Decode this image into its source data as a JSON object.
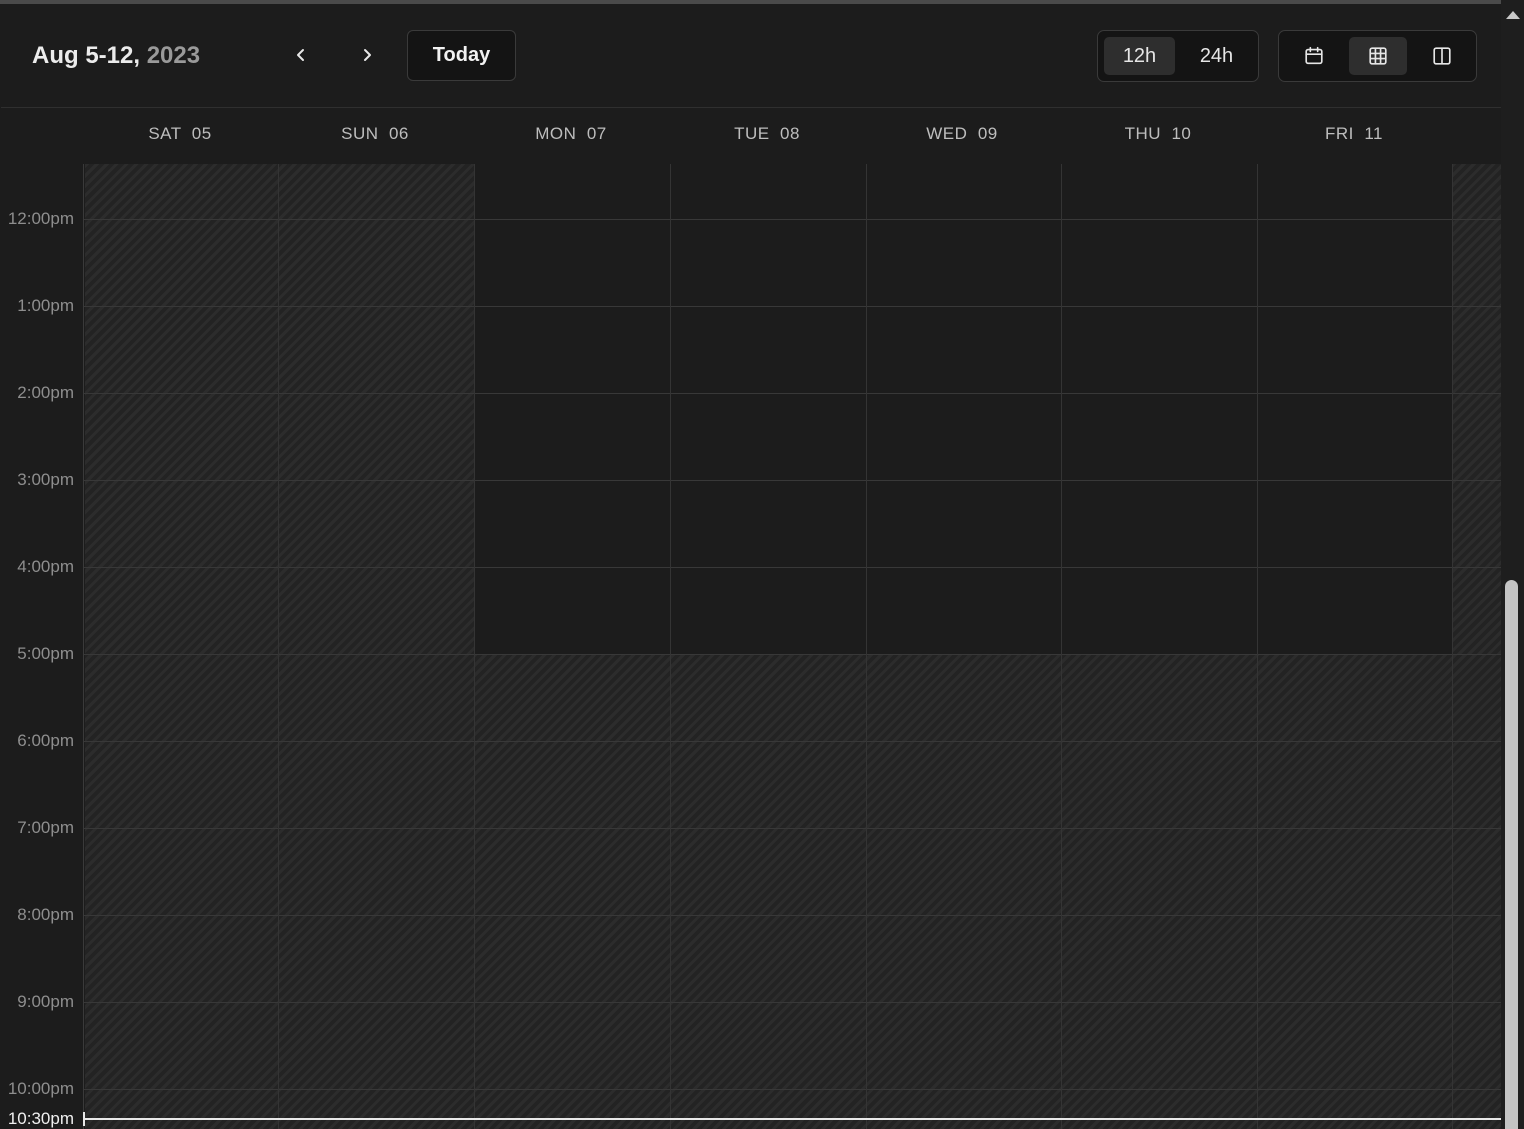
{
  "header": {
    "range": "Aug 5-12,",
    "year": "2023",
    "prev_icon": "chevron-left-icon",
    "next_icon": "chevron-right-icon",
    "today_label": "Today"
  },
  "time_format": {
    "options": [
      {
        "label": "12h",
        "active": true
      },
      {
        "label": "24h",
        "active": false
      }
    ]
  },
  "view_modes": [
    {
      "icon": "calendar-icon",
      "active": false
    },
    {
      "icon": "grid-icon",
      "active": true
    },
    {
      "icon": "columns-icon",
      "active": false
    }
  ],
  "days": [
    "SAT  05",
    "SUN  06",
    "MON  07",
    "TUE  08",
    "WED  09",
    "THU  10",
    "FRI  11"
  ],
  "hours": [
    "12:00pm",
    "1:00pm",
    "2:00pm",
    "3:00pm",
    "4:00pm",
    "5:00pm",
    "6:00pm",
    "7:00pm",
    "8:00pm",
    "9:00pm",
    "10:00pm"
  ],
  "now_label": "10:30pm",
  "colors": {
    "background": "#1c1c1c",
    "unavailable_hatch": "#2c2c2c",
    "now_line": "#e8e8e8"
  }
}
